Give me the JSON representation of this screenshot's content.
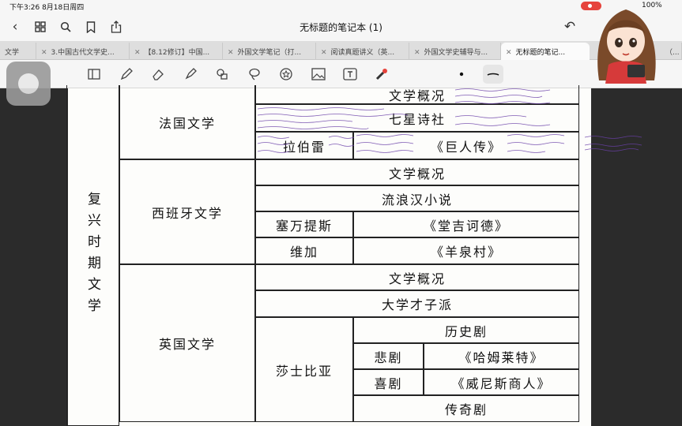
{
  "status": {
    "time": "下午3:26  8月18日周四",
    "battery": "100%"
  },
  "nav": {
    "title": "无标题的笔记本 (1)"
  },
  "tabs": [
    {
      "label": "文学",
      "active": false
    },
    {
      "label": "3.中国古代文学史...",
      "active": false
    },
    {
      "label": "【8.12修订】中国...",
      "active": false
    },
    {
      "label": "外国文学笔记（打...",
      "active": false
    },
    {
      "label": "阅读真题讲义（英...",
      "active": false
    },
    {
      "label": "外国文学史辅导与...",
      "active": false
    },
    {
      "label": "无标题的笔记...",
      "active": true
    },
    {
      "label": "（...",
      "active": false
    }
  ],
  "toolbar": {
    "tools": [
      "sidebar-icon",
      "pen-icon",
      "eraser-icon",
      "highlighter-icon",
      "shapes-icon",
      "lasso-icon",
      "sticker-icon",
      "image-icon",
      "text-icon",
      "laser-icon",
      "dot-icon",
      "stroke-icon"
    ]
  },
  "table": {
    "era": "复兴时期文学",
    "france": {
      "country": "法国文学",
      "r1": "文学概况",
      "r2": "七星诗社",
      "author": "拉伯雷",
      "work": "《巨人传》"
    },
    "spain": {
      "country": "西班牙文学",
      "r1": "文学概况",
      "r2": "流浪汉小说",
      "author1": "塞万提斯",
      "work1": "《堂吉诃德》",
      "author2": "维加",
      "work2": "《羊泉村》"
    },
    "england": {
      "country": "英国文学",
      "r1": "文学概况",
      "r2": "大学才子派",
      "author": "莎士比亚",
      "g1": "历史剧",
      "g2": "悲剧",
      "w2": "《哈姆莱特》",
      "g3": "喜剧",
      "w3": "《威尼斯商人》",
      "g4": "传奇剧"
    }
  },
  "colors": {
    "ink": "#222222",
    "annotation": "#6a3fa8",
    "record": "#e6433c"
  }
}
